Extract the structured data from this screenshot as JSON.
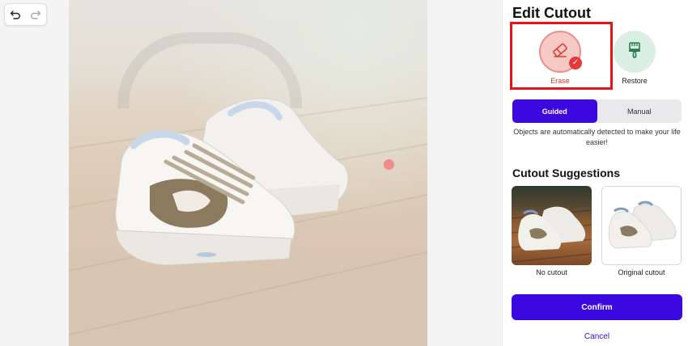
{
  "panel": {
    "title": "Edit Cutout",
    "tools": {
      "erase_label": "Erase",
      "restore_label": "Restore",
      "selected": "erase"
    },
    "mode_toggle": {
      "options": [
        "Guided",
        "Manual"
      ],
      "selected": "Guided",
      "description": "Objects are automatically detected to make your life easier!"
    },
    "suggestions": {
      "title": "Cutout Suggestions",
      "items": [
        {
          "label": "No cutout"
        },
        {
          "label": "Original cutout"
        }
      ]
    },
    "confirm_label": "Confirm",
    "cancel_label": "Cancel"
  },
  "colors": {
    "accent": "#3b08e0",
    "erase_red": "#e03a2e",
    "highlight_red": "#e4141b",
    "restore_green": "#d9efe3"
  },
  "icons": {
    "undo": "undo-icon",
    "redo": "redo-icon",
    "erase": "eraser-icon",
    "restore": "brush-icon",
    "check": "check-icon"
  }
}
